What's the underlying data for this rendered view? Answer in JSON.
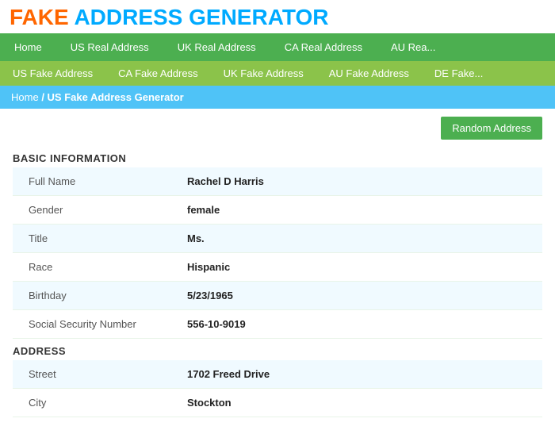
{
  "logo": {
    "fake": "FAKE",
    "rest": "ADDRESS GENERATOR"
  },
  "nav_primary": {
    "items": [
      {
        "label": "Home",
        "url": "#"
      },
      {
        "label": "US Real Address",
        "url": "#"
      },
      {
        "label": "UK Real Address",
        "url": "#"
      },
      {
        "label": "CA Real Address",
        "url": "#"
      },
      {
        "label": "AU Rea...",
        "url": "#"
      }
    ]
  },
  "nav_secondary": {
    "items": [
      {
        "label": "US Fake Address",
        "url": "#"
      },
      {
        "label": "CA Fake Address",
        "url": "#"
      },
      {
        "label": "UK Fake Address",
        "url": "#"
      },
      {
        "label": "AU Fake Address",
        "url": "#"
      },
      {
        "label": "DE Fake...",
        "url": "#"
      }
    ]
  },
  "breadcrumb": {
    "home": "Home",
    "separator": "/",
    "current": "US Fake Address Generator"
  },
  "buttons": {
    "random_address": "Random Address"
  },
  "sections": [
    {
      "id": "basic",
      "header": "BASIC INFORMATION",
      "rows": [
        {
          "label": "Full Name",
          "value": "Rachel D Harris"
        },
        {
          "label": "Gender",
          "value": "female"
        },
        {
          "label": "Title",
          "value": "Ms."
        },
        {
          "label": "Race",
          "value": "Hispanic"
        },
        {
          "label": "Birthday",
          "value": "5/23/1965"
        },
        {
          "label": "Social Security Number",
          "value": "556-10-9019"
        }
      ]
    },
    {
      "id": "address",
      "header": "ADDRESS",
      "rows": [
        {
          "label": "Street",
          "value": "1702 Freed Drive"
        },
        {
          "label": "City",
          "value": "Stockton"
        }
      ]
    }
  ]
}
